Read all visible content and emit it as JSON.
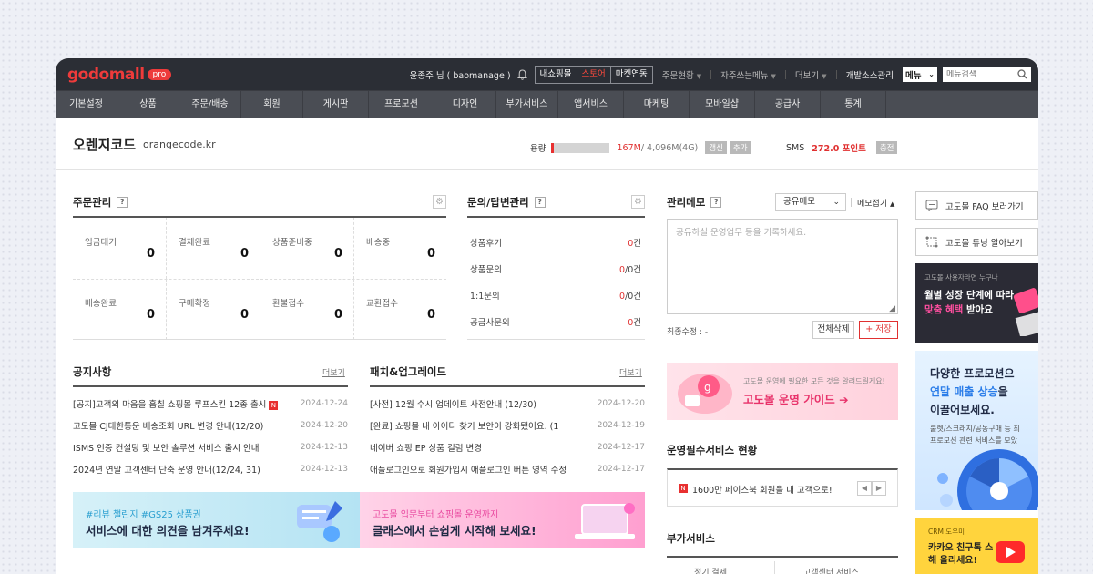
{
  "brand": {
    "logo": "godomall",
    "badge": "pro"
  },
  "topbar": {
    "user": "윤종주 님 ( baomanage )",
    "segments": [
      "내쇼핑몰",
      "스토어",
      "마켓연동"
    ],
    "links": [
      "주문현황",
      "자주쓰는메뉴",
      "더보기",
      "개발소스관리"
    ],
    "menu_select": "메뉴",
    "search_placeholder": "메뉴검색"
  },
  "nav": [
    "기본설정",
    "상품",
    "주문/배송",
    "회원",
    "게시판",
    "프로모션",
    "디자인",
    "부가서비스",
    "앱서비스",
    "마케팅",
    "모바일샵",
    "공급사",
    "통계"
  ],
  "shop": {
    "name": "오렌지코드",
    "domain": "orangecode.kr",
    "capacity_label": "용량",
    "capacity_used": "167M",
    "capacity_total": " / 4,096M(4G)",
    "capacity_fraction": 0.04,
    "capacity_btn1": "갱신",
    "capacity_btn2": "추가",
    "sms_label": "SMS",
    "sms_points": "272.0 포인트",
    "sms_btn": "충전"
  },
  "orders": {
    "title": "주문관리",
    "cells": [
      {
        "label": "입금대기",
        "value": "0"
      },
      {
        "label": "결제완료",
        "value": "0"
      },
      {
        "label": "상품준비중",
        "value": "0"
      },
      {
        "label": "배송중",
        "value": "0"
      },
      {
        "label": "배송완료",
        "value": "0"
      },
      {
        "label": "구매확정",
        "value": "0"
      },
      {
        "label": "환불접수",
        "value": "0"
      },
      {
        "label": "교환접수",
        "value": "0"
      }
    ]
  },
  "qa": {
    "title": "문의/답변관리",
    "rows": [
      {
        "label": "상품후기",
        "red": "0",
        "rest": "건"
      },
      {
        "label": "상품문의",
        "red": "0",
        "rest": "/0건"
      },
      {
        "label": "1:1문의",
        "red": "0",
        "rest": "/0건"
      },
      {
        "label": "공급사문의",
        "red": "0",
        "rest": "건"
      }
    ]
  },
  "memo": {
    "title": "관리메모",
    "select": "공유메모",
    "collapse": "메모접기",
    "placeholder": "공유하실 운영업무 등을 기록하세요.",
    "modified": "최종수정 : -",
    "delete_all": "전체삭제",
    "save": "저장"
  },
  "notice": {
    "title": "공지사항",
    "more": "더보기",
    "rows": [
      {
        "text": "[공지]고객의 마음을 훔칠 쇼핑몰 루프스킨 12종 출시",
        "date": "2024-12-24",
        "new": true
      },
      {
        "text": "고도몰 CJ대한통운 배송조회 URL 변경 안내(12/20)",
        "date": "2024-12-20",
        "new": false
      },
      {
        "text": "ISMS 인증 컨설팅 및 보안 솔루션 서비스 출시 안내",
        "date": "2024-12-13",
        "new": false
      },
      {
        "text": "2024년 연말 고객센터 단축 운영 안내(12/24, 31)",
        "date": "2024-12-13",
        "new": false
      }
    ]
  },
  "patch": {
    "title": "패치&업그레이드",
    "more": "더보기",
    "rows": [
      {
        "text": "[사전] 12월 수시 업데이트 사전안내 (12/30)",
        "date": "2024-12-20"
      },
      {
        "text": "[완료] 쇼핑몰 내 아이디 찾기 보안이 강화됐어요. (1",
        "date": "2024-12-19"
      },
      {
        "text": "네이버 쇼핑 EP 상품 컬럼 변경",
        "date": "2024-12-17"
      },
      {
        "text": "애플로그인으로 회원가입시 애플로그인 버튼 영역 수정",
        "date": "2024-12-17"
      }
    ]
  },
  "banners": {
    "review_tag": "#리뷰 챌린지 #GS25 상품권",
    "review_main": "서비스에 대한 의견을 남겨주세요!",
    "class_tag": "고도몰 입문부터 쇼핑몰 운영까지",
    "class_main": "클래스에서 손쉽게 시작해 보세요!",
    "guide_small": "고도몰 운영에 필요한 모든 것을 알려드릴게요!",
    "guide_main": "고도몰 운영 가이드"
  },
  "essential": {
    "title": "운영필수서비스 현황",
    "item": "1600만 페이스북 회원을 내 고객으로!"
  },
  "addon": {
    "title": "부가서비스",
    "row": [
      "정기 결제",
      "고객센터 서비스"
    ]
  },
  "side": {
    "faq": "고도몰 FAQ 보러가기",
    "tuning": "고도몰 튜닝 알아보기",
    "ad1_small": "고도몰 사용자라면 누구나",
    "ad1_line1": "월별 성장 단계에 따라",
    "ad1_red": "맞춤 혜택",
    "ad1_rest": " 받아요",
    "ad2_line1": "다양한 프로모션으",
    "ad2_blue": "연말 매출 상승",
    "ad2_tail": "을",
    "ad2_line3": "이끌어보세요.",
    "ad2_sub1": "룰렛/스크래치/공동구매 등 최",
    "ad2_sub2": "프로모션 관련 서비스를 모았",
    "ad3_small": "CRM 도우미",
    "ad3_main": "카카오 친구톡 스",
    "ad3_main2": "해 올리세요!"
  }
}
